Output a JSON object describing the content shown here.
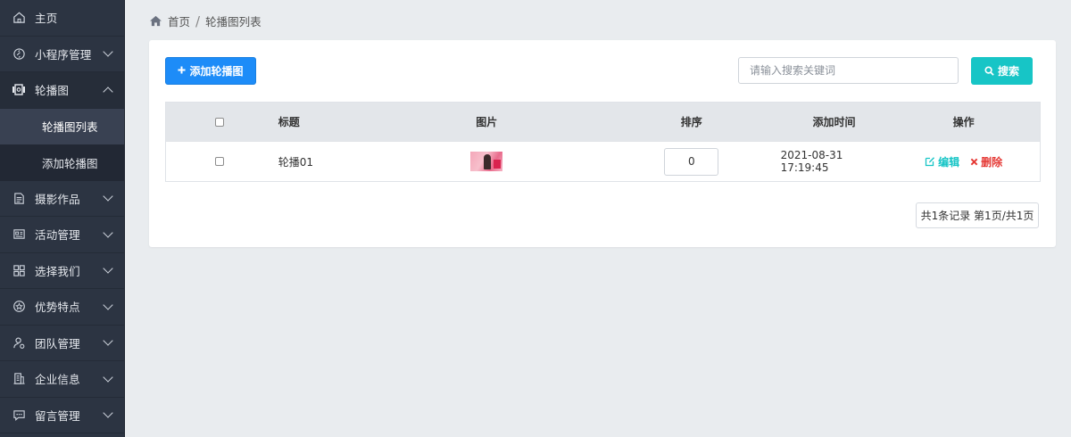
{
  "sidebar": {
    "items": [
      {
        "label": "主页",
        "icon": "home-outline-icon"
      },
      {
        "label": "小程序管理",
        "icon": "link-icon"
      },
      {
        "label": "轮播图",
        "icon": "gallery-icon",
        "expanded": true,
        "children": [
          {
            "label": "轮播图列表",
            "active": true
          },
          {
            "label": "添加轮播图"
          }
        ]
      },
      {
        "label": "摄影作品",
        "icon": "document-icon"
      },
      {
        "label": "活动管理",
        "icon": "id-card-icon"
      },
      {
        "label": "选择我们",
        "icon": "grid-icon"
      },
      {
        "label": "优势特点",
        "icon": "star-circle-icon"
      },
      {
        "label": "团队管理",
        "icon": "team-icon"
      },
      {
        "label": "企业信息",
        "icon": "building-icon"
      },
      {
        "label": "留言管理",
        "icon": "message-icon"
      }
    ]
  },
  "breadcrumb": {
    "home": "首页",
    "separator": "/",
    "current": "轮播图列表"
  },
  "toolbar": {
    "add_label": "添加轮播图",
    "search_placeholder": "请输入搜索关键词",
    "search_value": "",
    "search_label": "搜索"
  },
  "table": {
    "headers": {
      "title": "标题",
      "image": "图片",
      "sort": "排序",
      "time": "添加时间",
      "actions": "操作"
    },
    "rows": [
      {
        "title": "轮播01",
        "sort": "0",
        "time": "2021-08-31 17:19:45",
        "edit_label": "编辑",
        "delete_label": "删除"
      }
    ]
  },
  "pagination": {
    "summary": "共1条记录 第1页/共1页"
  },
  "colors": {
    "sidebar_bg": "#2c3442",
    "primary": "#1d8cf8",
    "accent": "#17c5c6",
    "danger": "#e53935",
    "page_bg": "#e9ecef"
  }
}
